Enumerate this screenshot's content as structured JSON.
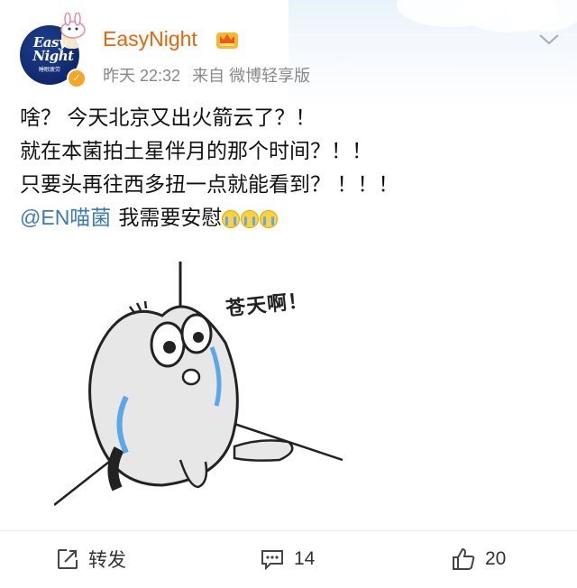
{
  "header": {
    "username": "EasyNight",
    "avatar_text_line1": "Easy",
    "avatar_text_line2": "Night",
    "avatar_subtext": "睡眠疲劳",
    "time": "昨天 22:32",
    "source": "来自 微博轻享版",
    "username_color": "#e8650b",
    "verified_color": "#f5a623"
  },
  "post": {
    "lines": [
      "啥？ 今天北京又出火箭云了？！",
      "就在本菌拍土星伴月的那个时间？！！",
      "只要头再往西多扭一点就能看到？ ！！！"
    ],
    "mention": "@EN喵菌",
    "last_text": "我需要安慰",
    "emoji_names": [
      "crying-emoji",
      "crying-emoji",
      "crying-emoji"
    ],
    "mention_color": "#3d7ab8"
  },
  "image": {
    "caption": "苍天啊！"
  },
  "actions": {
    "repost_label": "转发",
    "comment_count": "14",
    "like_count": "20"
  }
}
